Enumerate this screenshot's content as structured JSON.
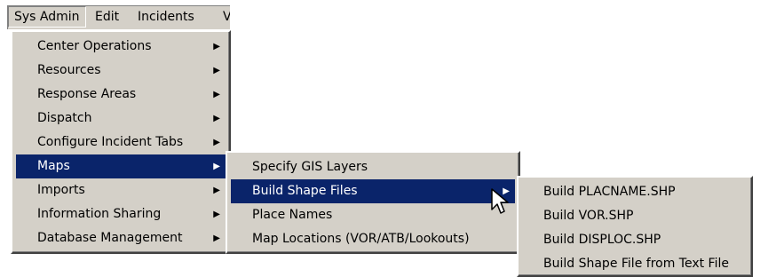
{
  "menubar": {
    "items": [
      {
        "label": "Sys Admin"
      },
      {
        "label": "Edit"
      },
      {
        "label": "Incidents"
      },
      {
        "label": "V"
      }
    ]
  },
  "sys_admin_menu": {
    "items": [
      {
        "label": "Center Operations",
        "arrow": "▶"
      },
      {
        "label": "Resources",
        "arrow": "▶"
      },
      {
        "label": "Response Areas",
        "arrow": "▶"
      },
      {
        "label": "Dispatch",
        "arrow": "▶"
      },
      {
        "label": "Configure Incident Tabs",
        "arrow": "▶"
      },
      {
        "label": "Maps",
        "arrow": "▶"
      },
      {
        "label": "Imports",
        "arrow": "▶"
      },
      {
        "label": "Information Sharing",
        "arrow": "▶"
      },
      {
        "label": "Database Management",
        "arrow": "▶"
      }
    ],
    "selected": "Maps"
  },
  "maps_menu": {
    "items": [
      {
        "label": "Specify GIS Layers"
      },
      {
        "label": "Build Shape Files",
        "arrow": "▶"
      },
      {
        "label": "Place Names"
      },
      {
        "label": "Map Locations (VOR/ATB/Lookouts)"
      }
    ],
    "selected": "Build Shape Files"
  },
  "build_shape_files_menu": {
    "items": [
      {
        "label": "Build PLACNAME.SHP"
      },
      {
        "label": "Build VOR.SHP"
      },
      {
        "label": "Build DISPLOC.SHP"
      },
      {
        "label": "Build Shape File from Text File"
      }
    ]
  },
  "colors": {
    "menu_bg": "#d4d0c8",
    "selection_bg": "#0a246a",
    "selection_text": "#ffffff"
  },
  "icons": {
    "submenu": "arrow-right-icon",
    "pointer": "mouse-pointer-icon"
  }
}
